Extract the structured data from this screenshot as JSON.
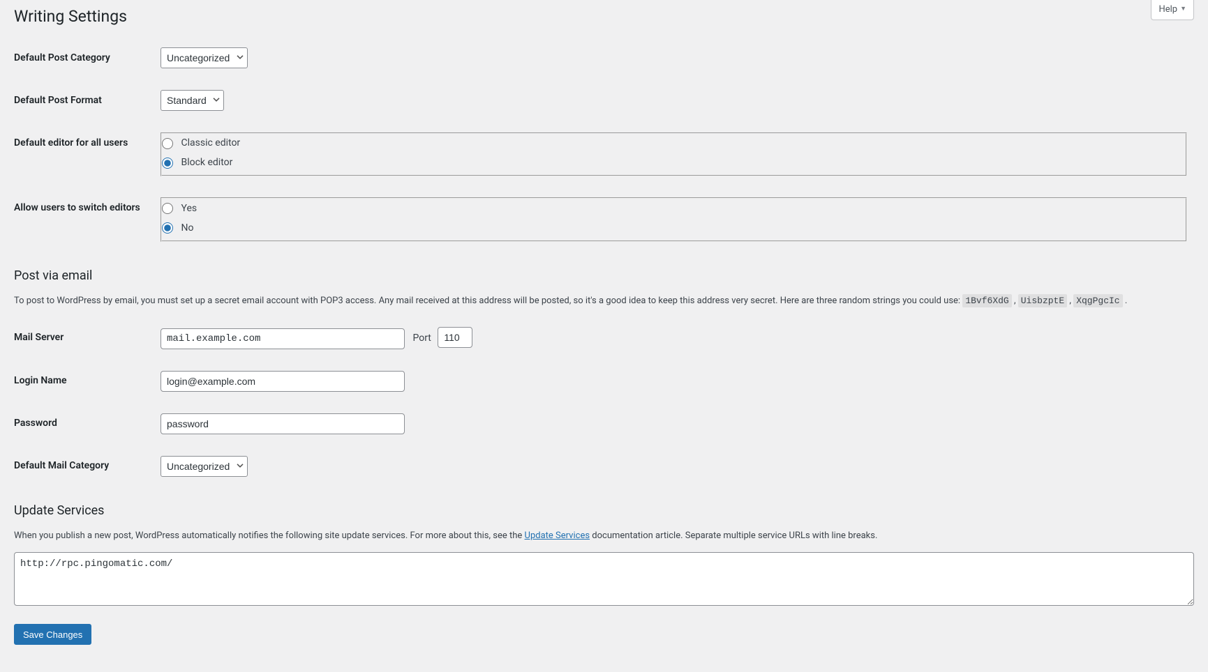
{
  "help": {
    "label": "Help"
  },
  "page": {
    "title": "Writing Settings"
  },
  "fields": {
    "default_category_label": "Default Post Category",
    "default_category_value": "Uncategorized",
    "default_format_label": "Default Post Format",
    "default_format_value": "Standard",
    "default_editor_label": "Default editor for all users",
    "editor_classic": "Classic editor",
    "editor_block": "Block editor",
    "allow_switch_label": "Allow users to switch editors",
    "yes": "Yes",
    "no": "No"
  },
  "post_email": {
    "heading": "Post via email",
    "desc_prefix": "To post to WordPress by email, you must set up a secret email account with POP3 access. Any mail received at this address will be posted, so it's a good idea to keep this address very secret. Here are three random strings you could use: ",
    "rand1": "1Bvf6XdG",
    "rand2": "UisbzptE",
    "rand3": "XqgPgcIc",
    "mail_server_label": "Mail Server",
    "mail_server_value": "mail.example.com",
    "port_label": "Port",
    "port_value": "110",
    "login_label": "Login Name",
    "login_value": "login@example.com",
    "password_label": "Password",
    "password_value": "password",
    "default_mail_cat_label": "Default Mail Category",
    "default_mail_cat_value": "Uncategorized"
  },
  "update_services": {
    "heading": "Update Services",
    "desc_prefix": "When you publish a new post, WordPress automatically notifies the following site update services. For more about this, see the ",
    "link_text": "Update Services",
    "desc_suffix": " documentation article. Separate multiple service URLs with line breaks.",
    "value": "http://rpc.pingomatic.com/"
  },
  "submit": {
    "label": "Save Changes"
  }
}
